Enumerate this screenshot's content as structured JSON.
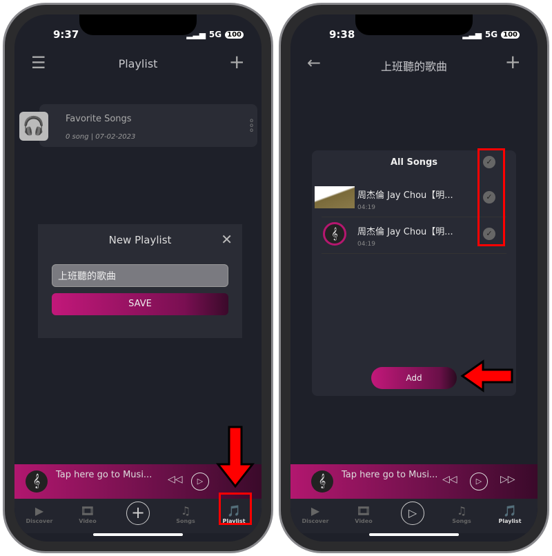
{
  "left": {
    "time": "9:37",
    "network": "5G",
    "battery": "100",
    "title": "Playlist",
    "playlist": {
      "name": "Favorite Songs",
      "meta": "0 song | 07-02-2023"
    },
    "dialog": {
      "title": "New Playlist",
      "input_value": "上班聽的歌曲",
      "save": "SAVE"
    },
    "mini_text": "Tap here go to Musi...",
    "tabs": [
      "Discover",
      "Video",
      "Songs",
      "Playlist"
    ]
  },
  "right": {
    "time": "9:38",
    "network": "5G",
    "battery": "100",
    "title": "上班聽的歌曲",
    "all_songs": "All Songs",
    "songs": [
      {
        "title": "周杰倫 Jay Chou【明...",
        "duration": "04:19"
      },
      {
        "title": "周杰倫 Jay Chou【明...",
        "duration": "04:19"
      }
    ],
    "add": "Add",
    "mini_text": "Tap here go to Musi...",
    "tabs": [
      "Discover",
      "Video",
      "Songs",
      "Playlist"
    ]
  },
  "colors": {
    "accent": "#c2187a",
    "background": "#1e2029",
    "annotation": "#ff0000"
  }
}
